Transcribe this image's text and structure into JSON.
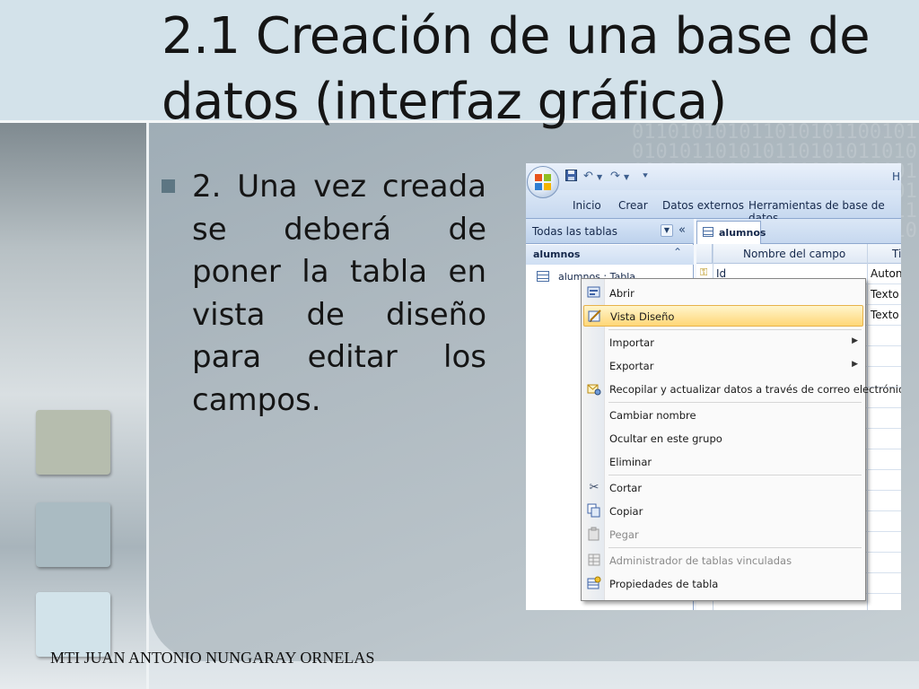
{
  "slide": {
    "title": "2.1 Creación de una base de datos (interfaz gráfica)",
    "bullet": "2. Una vez creada se deberá de poner la tabla en vista de diseño para editar los campos.",
    "footer": "MTI JUAN ANTONIO NUNGARAY ORNELAS"
  },
  "access": {
    "help_partial": "H",
    "ribbon_tabs": [
      "Inicio",
      "Crear",
      "Datos externos",
      "Herramientas de base de datos"
    ],
    "nav": {
      "title": "Todas las tablas",
      "group": "alumnos",
      "item": "alumnos : Tabla"
    },
    "doc_tab": "alumnos",
    "grid": {
      "col_field": "Nombre del campo",
      "col_type": "Ti",
      "rows": [
        {
          "field": "Id",
          "type": "Auton"
        },
        {
          "field": "",
          "type": "Texto"
        },
        {
          "field": "",
          "type": "Texto"
        }
      ]
    },
    "context_menu": {
      "items": [
        {
          "label": "Abrir",
          "icon": "open-icon"
        },
        {
          "label": "Vista Diseño",
          "icon": "design-view-icon",
          "highlighted": true
        },
        {
          "label": "Importar",
          "submenu": true
        },
        {
          "label": "Exportar",
          "submenu": true
        },
        {
          "label": "Recopilar y actualizar datos a través de correo electrónico",
          "icon": "collect-data-icon"
        },
        {
          "label": "Cambiar nombre"
        },
        {
          "label": "Ocultar en este grupo"
        },
        {
          "label": "Eliminar"
        },
        {
          "label": "Cortar",
          "icon": "cut-icon"
        },
        {
          "label": "Copiar",
          "icon": "copy-icon"
        },
        {
          "label": "Pegar",
          "icon": "paste-icon",
          "disabled": true
        },
        {
          "label": "Administrador de tablas vinculadas",
          "icon": "linked-table-manager-icon",
          "disabled": true
        },
        {
          "label": "Propiedades de tabla",
          "icon": "table-properties-icon"
        }
      ]
    }
  },
  "colors": {
    "menu_highlight": "#ffd777",
    "bullet": "#5d7683",
    "header_band": "#d3e2ea"
  }
}
